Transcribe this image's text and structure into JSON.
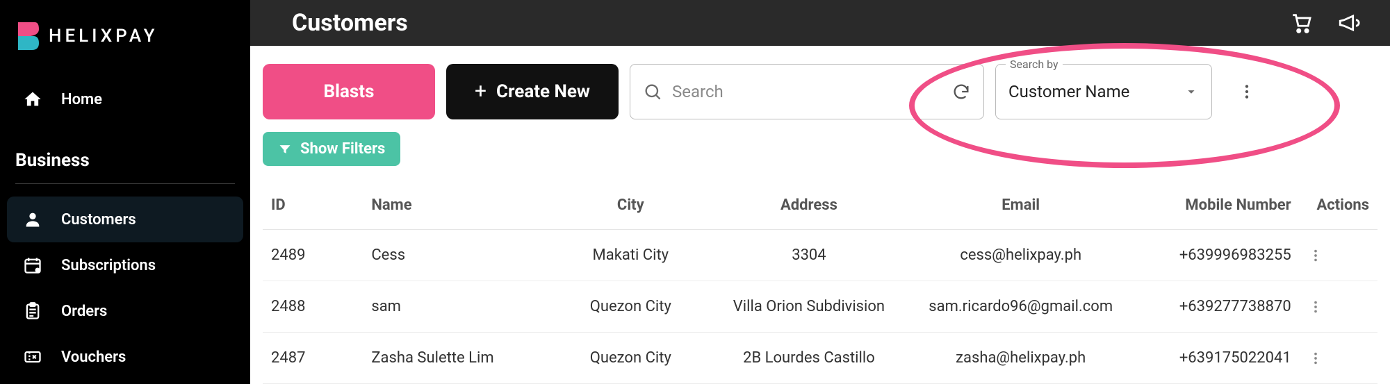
{
  "brand": {
    "name": "HELIXPAY"
  },
  "sidebar": {
    "home_label": "Home",
    "section_label": "Business",
    "items": [
      {
        "label": "Customers",
        "active": true
      },
      {
        "label": "Subscriptions"
      },
      {
        "label": "Orders"
      },
      {
        "label": "Vouchers"
      }
    ]
  },
  "topbar": {
    "title": "Customers"
  },
  "actions": {
    "blasts_label": "Blasts",
    "create_label": "Create New",
    "search_placeholder": "Search",
    "searchby_label": "Search by",
    "searchby_value": "Customer Name",
    "show_filters_label": "Show Filters"
  },
  "table": {
    "columns": [
      "ID",
      "Name",
      "City",
      "Address",
      "Email",
      "Mobile Number",
      "Actions"
    ],
    "rows": [
      {
        "id": "2489",
        "name": "Cess",
        "city": "Makati City",
        "address": "3304",
        "email": "cess@helixpay.ph",
        "mobile": "+639996983255"
      },
      {
        "id": "2488",
        "name": "sam",
        "city": "Quezon City",
        "address": "Villa Orion Subdivision",
        "email": "sam.ricardo96@gmail.com",
        "mobile": "+639277738870"
      },
      {
        "id": "2487",
        "name": "Zasha Sulette Lim",
        "city": "Quezon City",
        "address": "2B Lourdes Castillo",
        "email": "zasha@helixpay.ph",
        "mobile": "+639175022041"
      }
    ]
  },
  "colors": {
    "accent_pink": "#f04e86",
    "accent_teal": "#4cc3a5"
  }
}
